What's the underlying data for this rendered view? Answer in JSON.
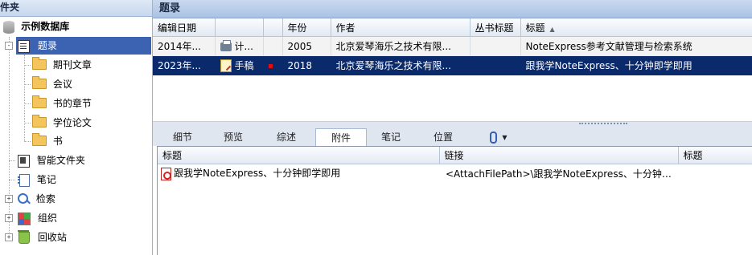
{
  "left_panel": {
    "header": "件夹",
    "tree": [
      {
        "label": "示例数据库",
        "icon": "database-icon",
        "bold": true
      },
      {
        "label": "题录",
        "icon": "list-icon",
        "selected": true
      },
      {
        "label": "期刊文章",
        "icon": "folder-icon"
      },
      {
        "label": "会议",
        "icon": "folder-icon"
      },
      {
        "label": "书的章节",
        "icon": "folder-icon"
      },
      {
        "label": "学位论文",
        "icon": "folder-icon"
      },
      {
        "label": "书",
        "icon": "folder-icon"
      },
      {
        "label": "智能文件夹",
        "icon": "smart-folder-icon"
      },
      {
        "label": "笔记",
        "icon": "notebook-icon"
      },
      {
        "label": "检索",
        "icon": "search-icon"
      },
      {
        "label": "组织",
        "icon": "organize-icon"
      },
      {
        "label": "回收站",
        "icon": "recycle-bin-icon"
      }
    ],
    "expanders": {
      "minus": "-",
      "plus": "+"
    }
  },
  "records_panel": {
    "title": "题录",
    "columns": [
      "编辑日期",
      "",
      "",
      "年份",
      "作者",
      "丛书标题",
      "标题"
    ],
    "sort_indicator": "▲",
    "rows": [
      {
        "date": "2014年...",
        "type_icon": "printer-icon",
        "type": "计...",
        "flag": "",
        "year": "2005",
        "author": "北京爱琴海乐之技术有限...",
        "series": "",
        "title": "NoteExpress参考文献管理与检索系统",
        "selected": false
      },
      {
        "date": "2023年...",
        "type_icon": "manuscript-icon",
        "type": "手稿",
        "flag": "red",
        "year": "2018",
        "author": "北京爱琴海乐之技术有限...",
        "series": "",
        "title": "跟我学NoteExpress、十分钟即学即用",
        "selected": true
      }
    ]
  },
  "detail_tabs": [
    "细节",
    "预览",
    "综述",
    "附件",
    "笔记",
    "位置"
  ],
  "active_tab": "附件",
  "attachments_table": {
    "columns": [
      "标题",
      "链接",
      "标题"
    ],
    "rows": [
      {
        "icon": "pdf-icon",
        "title": "跟我学NoteExpress、十分钟即学即用",
        "link": "<AttachFilePath>\\跟我学NoteExpress、十分钟即...",
        "extra": ""
      }
    ]
  },
  "colors": {
    "selection": "#0b2a6b",
    "tree_selection": "#3b63b2",
    "header": "#a9c2e4"
  }
}
